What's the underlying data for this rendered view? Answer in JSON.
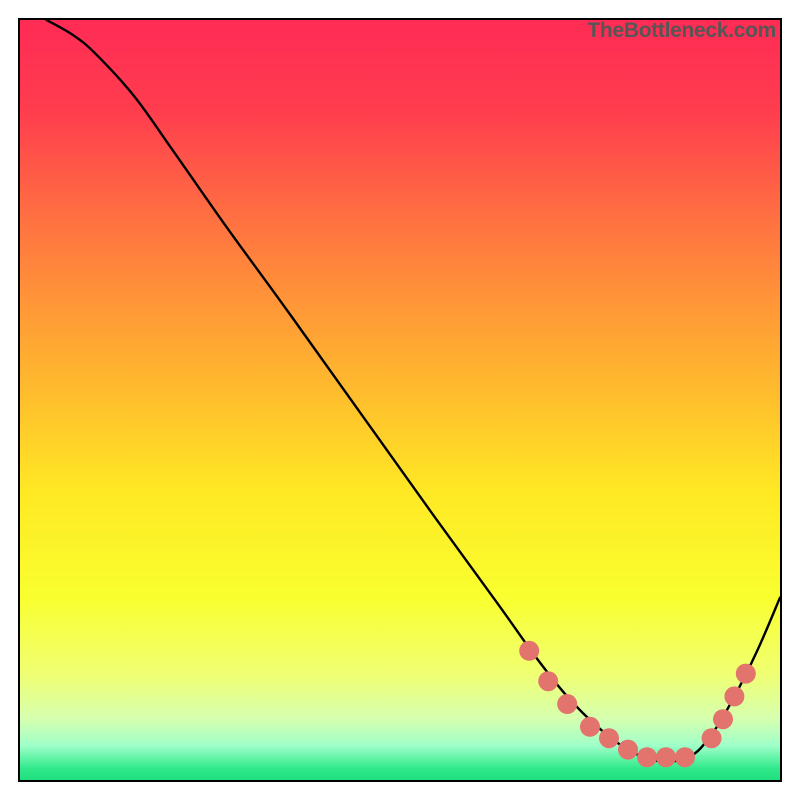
{
  "watermark": "TheBottleneck.com",
  "chart_data": {
    "type": "line",
    "title": "",
    "xlabel": "",
    "ylabel": "",
    "xlim": [
      0,
      100
    ],
    "ylim": [
      0,
      100
    ],
    "gradient_stops": [
      {
        "offset": 0.0,
        "color": "#ff2b55"
      },
      {
        "offset": 0.12,
        "color": "#ff3d4e"
      },
      {
        "offset": 0.3,
        "color": "#ff7e3e"
      },
      {
        "offset": 0.48,
        "color": "#ffb92e"
      },
      {
        "offset": 0.62,
        "color": "#ffe824"
      },
      {
        "offset": 0.76,
        "color": "#f9ff2f"
      },
      {
        "offset": 0.86,
        "color": "#f0ff72"
      },
      {
        "offset": 0.92,
        "color": "#d6ffb0"
      },
      {
        "offset": 0.955,
        "color": "#9effc9"
      },
      {
        "offset": 0.985,
        "color": "#30e98a"
      },
      {
        "offset": 1.0,
        "color": "#20df80"
      }
    ],
    "series": [
      {
        "name": "bottleneck-curve",
        "x": [
          3.5,
          7,
          10,
          15,
          20,
          27,
          35,
          45,
          55,
          63,
          68,
          72,
          76,
          80,
          84,
          88,
          91,
          94,
          97,
          100
        ],
        "y": [
          100,
          98,
          95.5,
          90,
          83,
          73,
          62,
          48,
          34,
          23,
          16,
          11,
          7,
          4,
          2.5,
          3,
          6,
          11,
          17,
          24
        ]
      }
    ],
    "markers": {
      "name": "highlight-dots",
      "x": [
        67,
        69.5,
        72,
        75,
        77.5,
        80,
        82.5,
        85,
        87.5,
        91,
        92.5,
        94,
        95.5
      ],
      "y": [
        17,
        13,
        10,
        7,
        5.5,
        4,
        3,
        3,
        3,
        5.5,
        8,
        11,
        14
      ]
    }
  }
}
